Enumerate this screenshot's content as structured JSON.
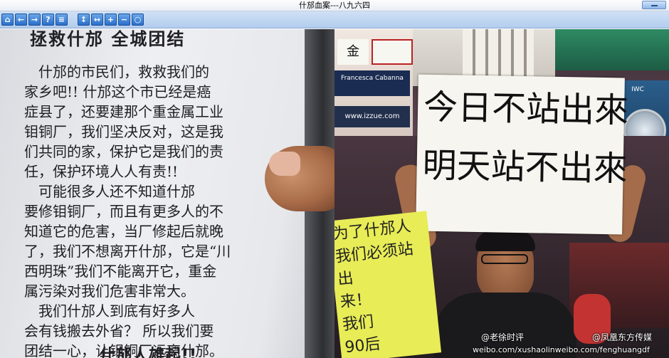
{
  "window": {
    "title": "什邡血案---八九六四"
  },
  "toolbar": {
    "buttons": [
      {
        "name": "home-icon",
        "glyph": "⌂"
      },
      {
        "name": "back-arrow-icon",
        "glyph": "←"
      },
      {
        "name": "forward-arrow-icon",
        "glyph": "→"
      },
      {
        "name": "help-icon",
        "glyph": "?"
      },
      {
        "name": "page-icon",
        "glyph": "≡"
      },
      {
        "name": "fit-height-icon",
        "glyph": "↕"
      },
      {
        "name": "fit-width-icon",
        "glyph": "↔"
      },
      {
        "name": "zoom-in-icon",
        "glyph": "+"
      },
      {
        "name": "zoom-out-icon",
        "glyph": "−"
      },
      {
        "name": "zoom-fit-icon",
        "glyph": "○"
      }
    ]
  },
  "leaflet": {
    "title": "拯救什邡  全城团结",
    "body": "　什邡的市民们，救救我们的\n家乡吧!! 什邡这个市已经是癌\n症县了，还要建那个重金属工业\n钼铜厂，我们坚决反对，这是我\n们共同的家，保护它是我们的责\n任，保护环境人人有责!!\n　可能很多人还不知道什邡\n要修钼铜厂，而且有更多人的不\n知道它的危害，当厂修起后就晚\n了，我们不想离开什邡，它是“川\n西明珠”我们不能离开它，重金\n属污染对我们危害非常大。\n　我们什邡人到底有好多人\n会有钱搬去外省？ 所以我们要\n团结一心，让钼铜厂远离什邡。",
    "footer": "什邡人雄起!!"
  },
  "protest": {
    "placard_line1": "今日不站出來",
    "placard_line2": "明天站不出來",
    "yellow_sign_text": "为了什邡人\n我们必须站出\n来！\n我们\n90后",
    "shop_sign_1": "Francesca Cabanna",
    "shop_sign_2": "www.izzue.com",
    "watermark_handle1": "@老徐时评",
    "watermark_handle2": "@凤凰东方传媒",
    "watermark_url": "weibo.com/xushaolinweibo.com/fenghuangdf",
    "watch_brand": "IWC"
  }
}
